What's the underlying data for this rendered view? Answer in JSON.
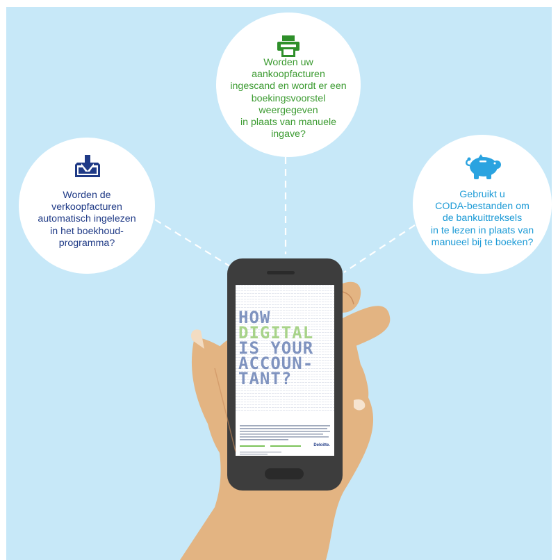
{
  "bubbles": {
    "left": {
      "lines": [
        "Worden de",
        "verkoopfacturen",
        "automatisch ingelezen",
        "in het boekhoud-",
        "programma?"
      ],
      "icon": "inbox-download-icon",
      "color": "#1f3a86"
    },
    "middle": {
      "lines": [
        "Worden uw",
        "aankoopfacturen",
        "ingescand en wordt er een",
        "boekingsvoorstel",
        "weergegeven",
        "in plaats van manuele",
        "ingave?"
      ],
      "icon": "printer-scanner-icon",
      "color": "#3a9a2f"
    },
    "right": {
      "lines": [
        "Gebruikt u",
        "CODA-bestanden om",
        "de bankuittreksels",
        "in te lezen in plaats van",
        "manueel bij te boeken?"
      ],
      "icon": "piggy-bank-icon",
      "color": "#1b9ad6"
    }
  },
  "phone": {
    "headline_lines": [
      "HOW",
      "DIGITAL",
      "IS YOUR",
      "ACCOUN-",
      "TANT?"
    ],
    "brand": "Deloitte."
  },
  "colors": {
    "background": "#c7e8f8",
    "skin": "#e3b482",
    "skin_shadow": "#c98e5e",
    "phone_body": "#3d3d3d"
  }
}
